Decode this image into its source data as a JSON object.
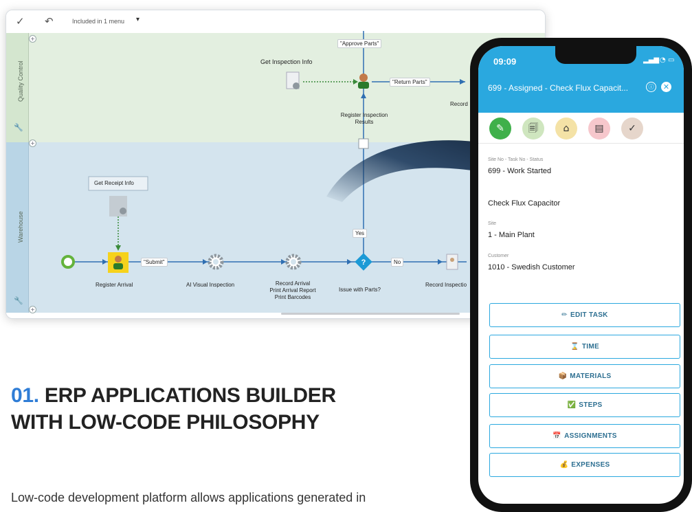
{
  "workflow": {
    "toolbar": {
      "included_label": "Included in 1 menu"
    },
    "lanes": {
      "quality_control": "Quality Control",
      "warehouse": "Warehouse"
    },
    "nodes": {
      "get_inspection_info": "Get Inspection Info",
      "register_inspection_results": "Register Inspection Results",
      "record": "Record",
      "get_receipt_info": "Get Receipt Info",
      "register_arrival": "Register Arrival",
      "ai_visual_inspection": "AI Visual Inspection",
      "record_arrival_1": "Record Arrival",
      "record_arrival_2": "Print Arrival Report",
      "record_arrival_3": "Print Barcodes",
      "issue_with_parts": "Issue with Parts?",
      "record_inspection": "Record Inspectio"
    },
    "flows": {
      "approve_parts": "\"Approve Parts\"",
      "return_parts": "\"Return Parts\"",
      "submit": "\"Submit\"",
      "yes": "Yes",
      "no": "No"
    }
  },
  "heading": {
    "number": "01.",
    "title": "ERP APPLICATIONS BUILDER WITH LOW-CODE PHILOSOPHY"
  },
  "subtext": "Low-code development platform allows applications generated in",
  "phone": {
    "time": "09:09",
    "title": "699 - Assigned - Check Flux Capacit...",
    "fields": [
      {
        "label": "Site No - Task No - Status",
        "value": "699 - Work Started"
      },
      {
        "label": "",
        "value": "Check Flux Capacitor"
      },
      {
        "label": "Site",
        "value": "1 - Main Plant"
      },
      {
        "label": "Customer",
        "value": "1010 - Swedish Customer"
      }
    ],
    "buttons": [
      {
        "icon": "✏",
        "label": "EDIT TASK"
      },
      {
        "icon": "⌛",
        "label": "TIME"
      },
      {
        "icon": "📦",
        "label": "MATERIALS"
      },
      {
        "icon": "✅",
        "label": "STEPS"
      },
      {
        "icon": "📅",
        "label": "ASSIGNMENTS"
      },
      {
        "icon": "💰",
        "label": "EXPENSES"
      }
    ]
  },
  "colors": {
    "accent": "#2f7dd6",
    "app_header": "#2aa8df",
    "start_node": "#64b33c"
  }
}
